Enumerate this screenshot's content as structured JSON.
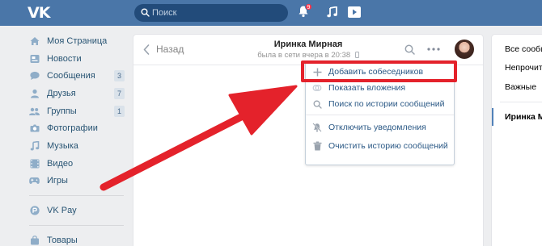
{
  "topbar": {
    "logo": "VK",
    "search_placeholder": "Поиск",
    "notifications_count": "9"
  },
  "sidebar": {
    "items": [
      {
        "label": "Моя Страница",
        "icon": "home-icon"
      },
      {
        "label": "Новости",
        "icon": "news-icon"
      },
      {
        "label": "Сообщения",
        "icon": "messages-icon",
        "count": "3"
      },
      {
        "label": "Друзья",
        "icon": "friends-icon",
        "count": "7"
      },
      {
        "label": "Группы",
        "icon": "groups-icon",
        "count": "1"
      },
      {
        "label": "Фотографии",
        "icon": "camera-icon"
      },
      {
        "label": "Музыка",
        "icon": "music-icon"
      },
      {
        "label": "Видео",
        "icon": "video-icon"
      },
      {
        "label": "Игры",
        "icon": "gamepad-icon"
      }
    ],
    "vkpay": {
      "label": "VK Pay",
      "icon": "vkpay-icon"
    },
    "goods": {
      "label": "Товары",
      "icon": "bag-icon"
    }
  },
  "chat": {
    "back_label": "Назад",
    "name": "Иринка Мирная",
    "status": "была в сети вчера в 20:38"
  },
  "menu": {
    "items": [
      {
        "label": "Добавить собеседников",
        "icon": "plus-icon"
      },
      {
        "label": "Показать вложения",
        "icon": "attachment-icon"
      },
      {
        "label": "Поиск по истории сообщений",
        "icon": "search-icon"
      },
      {
        "label": "Отключить уведомления",
        "icon": "mute-icon"
      },
      {
        "label": "Очистить историю сообщений",
        "icon": "trash-icon"
      }
    ]
  },
  "right_panel": {
    "filters": [
      "Все сообщения",
      "Непрочитанные",
      "Важные"
    ],
    "active_chat": "Иринка Мирная"
  },
  "colors": {
    "header": "#4a76a8",
    "link": "#2a5885",
    "highlight": "#e4222b"
  }
}
